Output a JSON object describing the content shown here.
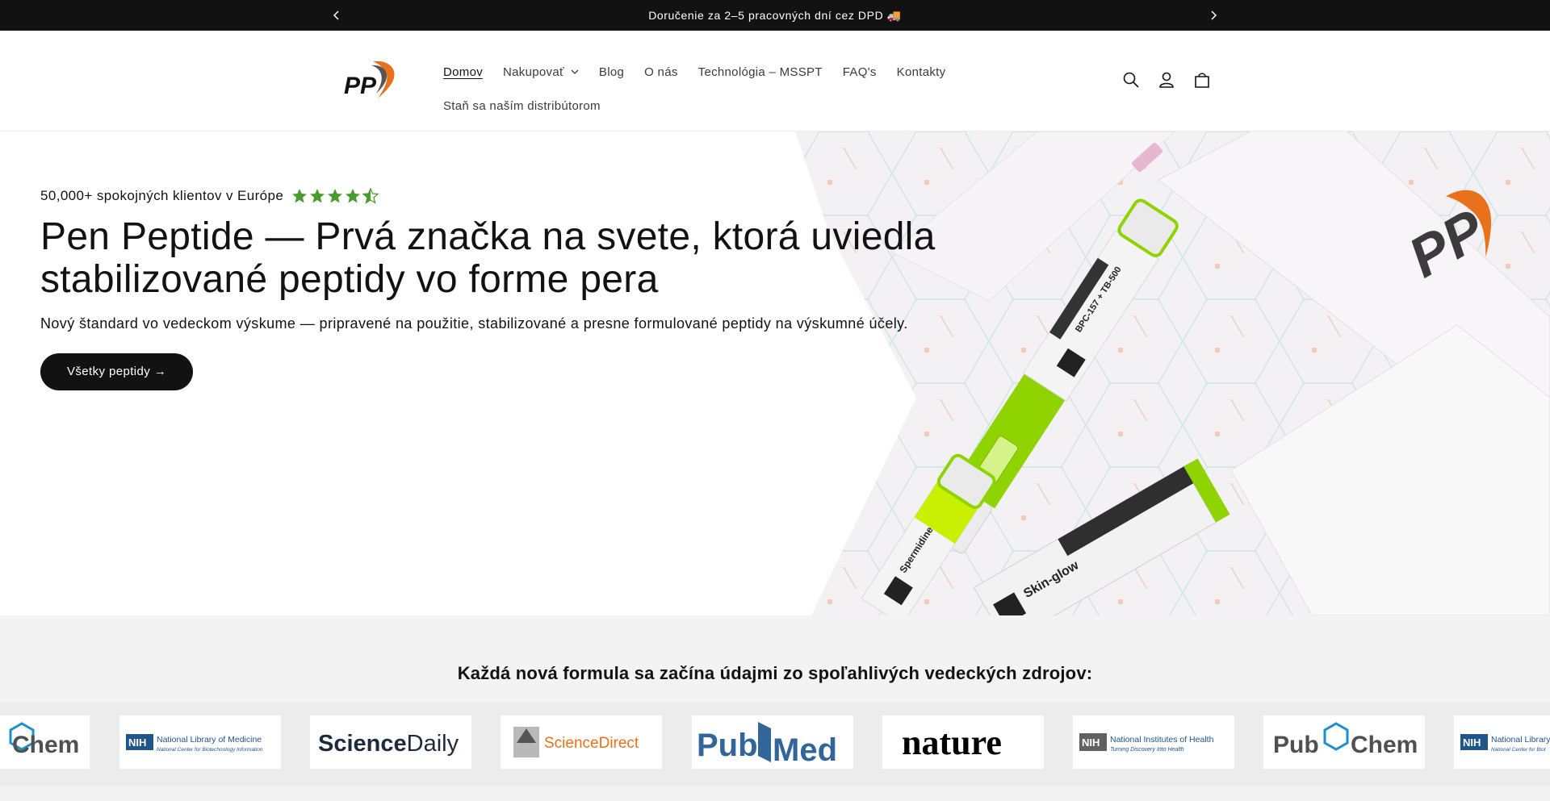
{
  "announcement": {
    "text": "Doručenie za 2–5 pracovných dní cez DPD 🚚"
  },
  "header": {
    "logo_text": "PP",
    "nav": [
      {
        "label": "Domov",
        "active": true
      },
      {
        "label": "Nakupovať"
      },
      {
        "label": "Blog"
      },
      {
        "label": "O nás"
      },
      {
        "label": "Technológia – MSSPT"
      },
      {
        "label": "FAQ's"
      },
      {
        "label": "Kontakty"
      },
      {
        "label": "Staň sa naším distribútorom"
      }
    ],
    "icons": [
      "search-icon",
      "account-icon",
      "cart-icon"
    ]
  },
  "hero": {
    "rating_text": "50,000+ spokojných klientov v Európe",
    "rating_value": 4.5,
    "title": "Pen Peptide — Prvá značka na svete, ktorá uviedla stabilizované peptidy vo forme pera",
    "subtitle": "Nový štandard vo vedeckom výskume — pripravené na použitie, stabilizované a presne formulované peptidy na výskumné účely.",
    "cta": "Všetky peptidy →",
    "product_labels": [
      "BPC-157 + TB-500",
      "Spermidine",
      "Skin-glow"
    ]
  },
  "sources": {
    "heading": "Každá nová formula sa začína údajmi zo spoľahlivých vedeckých zdrojov:",
    "logos": [
      {
        "name": "pubchem",
        "text": "Chem"
      },
      {
        "name": "nlm",
        "badge": "NIH",
        "line1": "National Library of Medicine",
        "line2": "National Center for Biotechnology Information"
      },
      {
        "name": "sciencedaily",
        "text1": "Science",
        "text2": "Daily"
      },
      {
        "name": "sciencedirect",
        "text": "ScienceDirect"
      },
      {
        "name": "pubmed",
        "text1": "Pub",
        "text2": "Med"
      },
      {
        "name": "nature",
        "text": "nature"
      },
      {
        "name": "nih",
        "badge": "NIH",
        "line1": "National Institutes of Health",
        "line2": "Turning Discovery Into Health"
      },
      {
        "name": "pubchem",
        "text1": "Pub",
        "text2": "Chem"
      },
      {
        "name": "nlm",
        "badge": "NIH",
        "line1": "National Library",
        "line2": "National Center for Biot"
      }
    ]
  },
  "colors": {
    "dark": "#121212",
    "star_green": "#4b9b2f",
    "pen_lime": "#8fd400",
    "pubmed_blue": "#326599",
    "nih_blue": "#20558a",
    "sd_orange": "#e9711c"
  }
}
